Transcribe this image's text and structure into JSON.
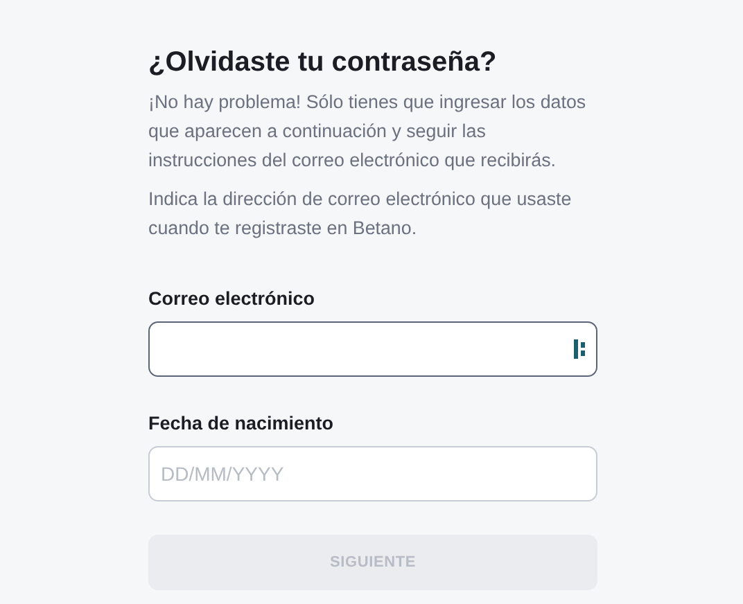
{
  "title": "¿Olvidaste tu contraseña?",
  "paragraphs": [
    "¡No hay problema! Sólo tienes que ingresar los datos que aparecen a continuación y seguir las instrucciones del correo electrónico que recibirás.",
    "Indica la dirección de correo electrónico que usaste cuando te registraste en Betano."
  ],
  "fields": [
    {
      "label": "Correo electrónico",
      "focused": true,
      "kind": "email"
    },
    {
      "label": "Fecha de nacimiento",
      "placeholder": "DD/MM/YYYY",
      "focused": false,
      "kind": "date"
    }
  ],
  "button": {
    "label": "SIGUIENTE",
    "disabled": true
  }
}
